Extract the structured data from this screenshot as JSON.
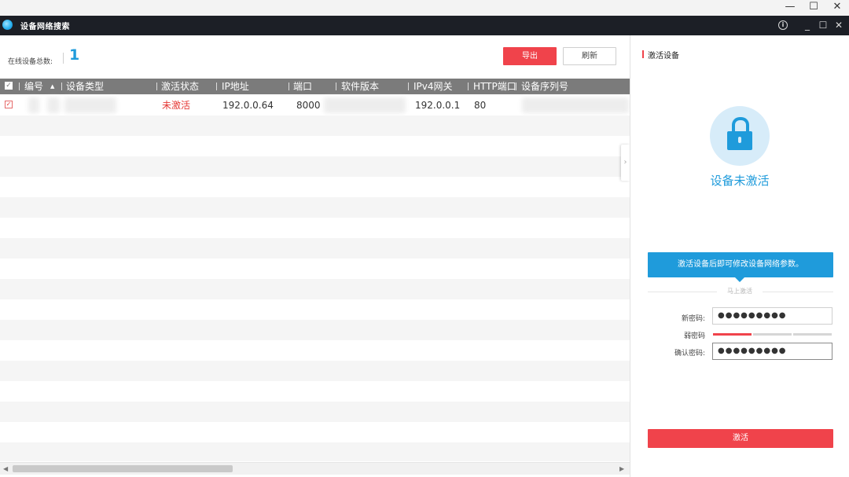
{
  "os_titlebar": {
    "minimize": "—",
    "maximize": "☐",
    "close": "✕"
  },
  "app": {
    "title": "设备网络搜索",
    "info": "i",
    "minimize": "_",
    "maximize": "☐",
    "close": "✕"
  },
  "toolbar": {
    "online_label": "在线设备总数:",
    "online_count": "1",
    "export_label": "导出",
    "refresh_label": "刷新"
  },
  "table": {
    "columns": [
      "编号",
      "设备类型",
      "激活状态",
      "IP地址",
      "端口",
      "软件版本",
      "IPv4网关",
      "HTTP端口",
      "设备序列号"
    ],
    "rows": [
      {
        "checked": true,
        "status": "未激活",
        "ip": "192.0.0.64",
        "port": "8000",
        "gateway": "192.0.0.1",
        "http_port": "80"
      }
    ]
  },
  "panel": {
    "title": "激活设备",
    "state": "设备未激活",
    "banner": "激活设备后即可修改设备网络参数。",
    "divider": "马上激活",
    "new_password_label": "新密码:",
    "new_password_value": "●●●●●●●●●",
    "strength_label": "弱密码",
    "strength_level": "1/3",
    "confirm_label": "确认密码:",
    "confirm_value": "●●●●●●●●●",
    "activate_label": "激活"
  },
  "colors": {
    "accent_red": "#f0434b",
    "accent_blue": "#1f9bdb",
    "header_dark": "#1c1f26",
    "table_header": "#7b7b7b"
  },
  "icons": [
    "app-logo-icon",
    "info-icon",
    "lock-icon",
    "chevron-right-icon",
    "checkbox-icon"
  ]
}
